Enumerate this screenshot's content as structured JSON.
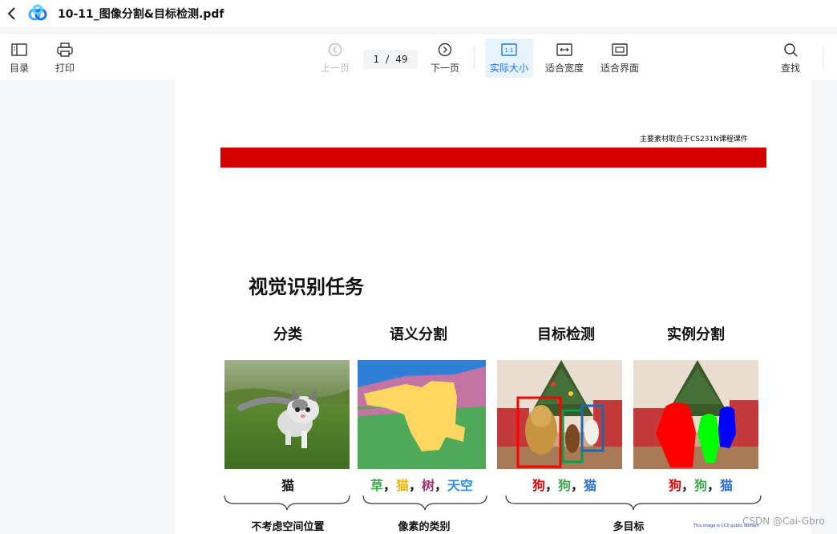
{
  "titlebar": {
    "title": "10-11_图像分割&目标检测.pdf"
  },
  "toolbar": {
    "toc_label": "目录",
    "print_label": "打印",
    "prev_label": "上一页",
    "current_page": "1",
    "page_separator": "/",
    "total_pages": "49",
    "next_label": "下一页",
    "actual_size_label": "实际大小",
    "actual_size_icon_text": "1:1",
    "fit_width_label": "适合宽度",
    "fit_page_label": "适合界面",
    "search_label": "查找"
  },
  "slide": {
    "source_note": "主要素材取自于CS231N课程课件",
    "title": "视觉识别任务",
    "columns": [
      {
        "title": "分类",
        "caption": "猫"
      },
      {
        "title": "语义分割",
        "caption_parts": [
          "草",
          "，",
          "猫",
          "，",
          "树",
          "，",
          "天空"
        ]
      },
      {
        "title": "目标检测",
        "caption_parts": [
          "狗",
          "，",
          "狗",
          "，",
          "猫"
        ]
      },
      {
        "title": "实例分割",
        "caption_parts": [
          "狗",
          "，",
          "狗",
          "，",
          "猫"
        ]
      }
    ],
    "bottom_labels": [
      "不考虑空间位置",
      "像素的类别",
      "多目标"
    ],
    "tiny_note": "This image is CC0 public domain"
  },
  "watermark": "CSDN @Cai-Gbro",
  "colors": {
    "red_bar": "#d40000",
    "active_blue": "#1677ff",
    "caption_red": "#e00000",
    "caption_green": "#3aa84a",
    "caption_blue": "#2b6fd6",
    "caption_yellow": "#f0b400",
    "caption_purple": "#a0326e",
    "caption_sky": "#2a8ee0"
  }
}
